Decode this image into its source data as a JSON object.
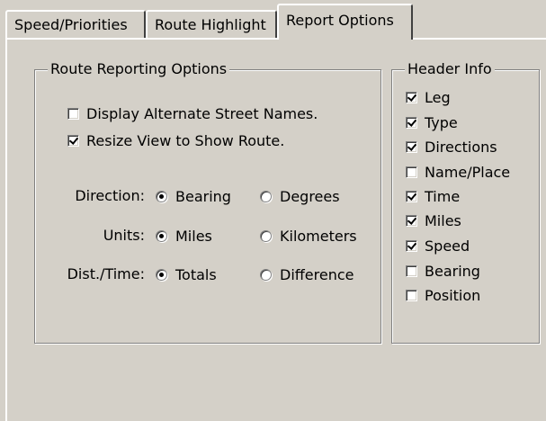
{
  "tabs": [
    "Speed/Priorities",
    "Route Highlight",
    "Report Options"
  ],
  "active_tab": "Report Options",
  "route_reporting": {
    "title": "Route Reporting Options",
    "checkboxes": [
      {
        "label": "Display Alternate Street Names.",
        "checked": false
      },
      {
        "label": "Resize View to Show Route.",
        "checked": true
      }
    ],
    "direction": {
      "label": "Direction:",
      "options": [
        "Bearing",
        "Degrees"
      ],
      "selected": "Bearing"
    },
    "units": {
      "label": "Units:",
      "options": [
        "Miles",
        "Kilometers"
      ],
      "selected": "Miles"
    },
    "dist_time": {
      "label": "Dist./Time:",
      "options": [
        "Totals",
        "Difference"
      ],
      "selected": "Totals"
    }
  },
  "header_info": {
    "title": "Header Info",
    "items": [
      {
        "label": "Leg",
        "checked": true
      },
      {
        "label": "Type",
        "checked": true
      },
      {
        "label": "Directions",
        "checked": true
      },
      {
        "label": "Name/Place",
        "checked": false
      },
      {
        "label": "Time",
        "checked": true
      },
      {
        "label": "Miles",
        "checked": true
      },
      {
        "label": "Speed",
        "checked": true
      },
      {
        "label": "Bearing",
        "checked": false
      },
      {
        "label": "Position",
        "checked": false
      }
    ]
  }
}
